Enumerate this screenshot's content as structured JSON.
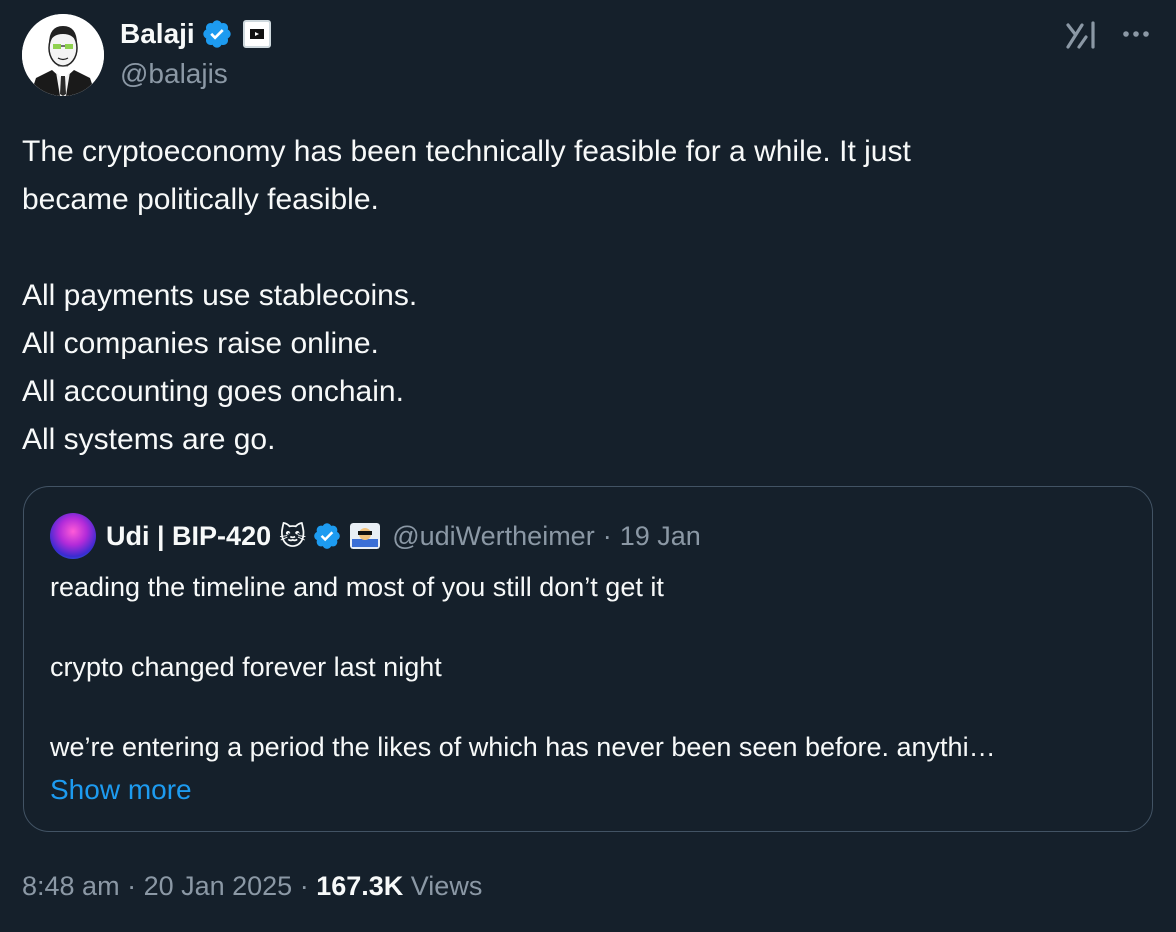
{
  "author": {
    "name": "Balaji",
    "handle": "@balajis"
  },
  "tweet": {
    "text": "The cryptoeconomy has been technically feasible for a while. It just\nbecame politically feasible.\n\nAll payments use stablecoins.\nAll companies raise online.\nAll accounting goes onchain.\nAll systems are go."
  },
  "quote": {
    "name": "Udi | BIP-420",
    "emoji": "🐱",
    "handle": "@udiWertheimer",
    "separator": "·",
    "date": "19 Jan",
    "lines": [
      "reading the timeline and most of you still don’t get it",
      "crypto changed forever last night",
      "we’re entering a period the likes of which has never been seen before. anythi…"
    ],
    "show_more": "Show more"
  },
  "footer": {
    "time": "8:48 am",
    "sep1": " · ",
    "date": "20 Jan 2025",
    "sep2": " · ",
    "views_count": "167.3K",
    "views_label": " Views"
  },
  "colors": {
    "background": "#15202b",
    "text": "#f7f9f9",
    "secondary": "#8b98a5",
    "accent": "#1d9bf0",
    "border": "#425364"
  },
  "icons": [
    "verified-badge-icon",
    "affiliate-badge-icon",
    "grok-icon",
    "more-options-icon"
  ]
}
